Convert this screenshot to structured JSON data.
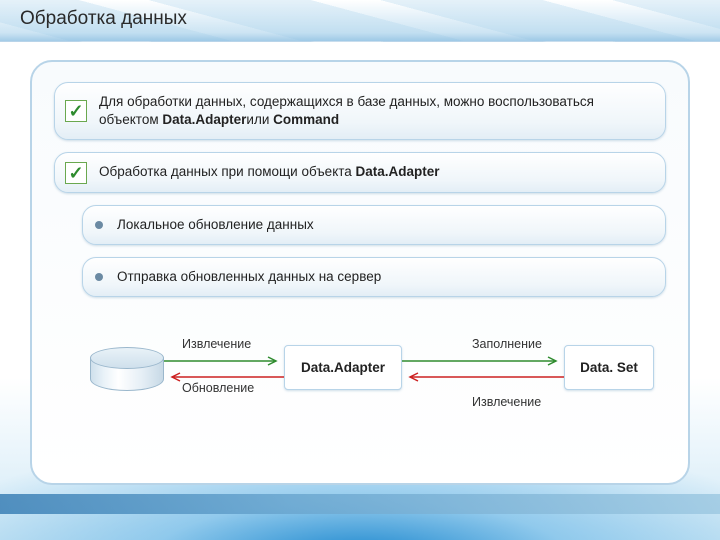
{
  "title": "Обработка данных",
  "cards": {
    "c1_pre": "Для обработки данных, содержащихся в базе данных, можно воспользоваться объектом ",
    "c1_b1": "Data.Adapter",
    "c1_mid": "или ",
    "c1_b2": "Command",
    "c2_pre": "Обработка данных при помощи объекта ",
    "c2_b": "Data.Adapter",
    "s1": "Локальное обновление данных",
    "s2": "Отправка обновленных данных на сервер"
  },
  "diagram": {
    "extract": "Извлечение",
    "update": "Обновление",
    "fill": "Заполнение",
    "adapter": "Data.Adapter",
    "dataset": "Data. Set"
  }
}
